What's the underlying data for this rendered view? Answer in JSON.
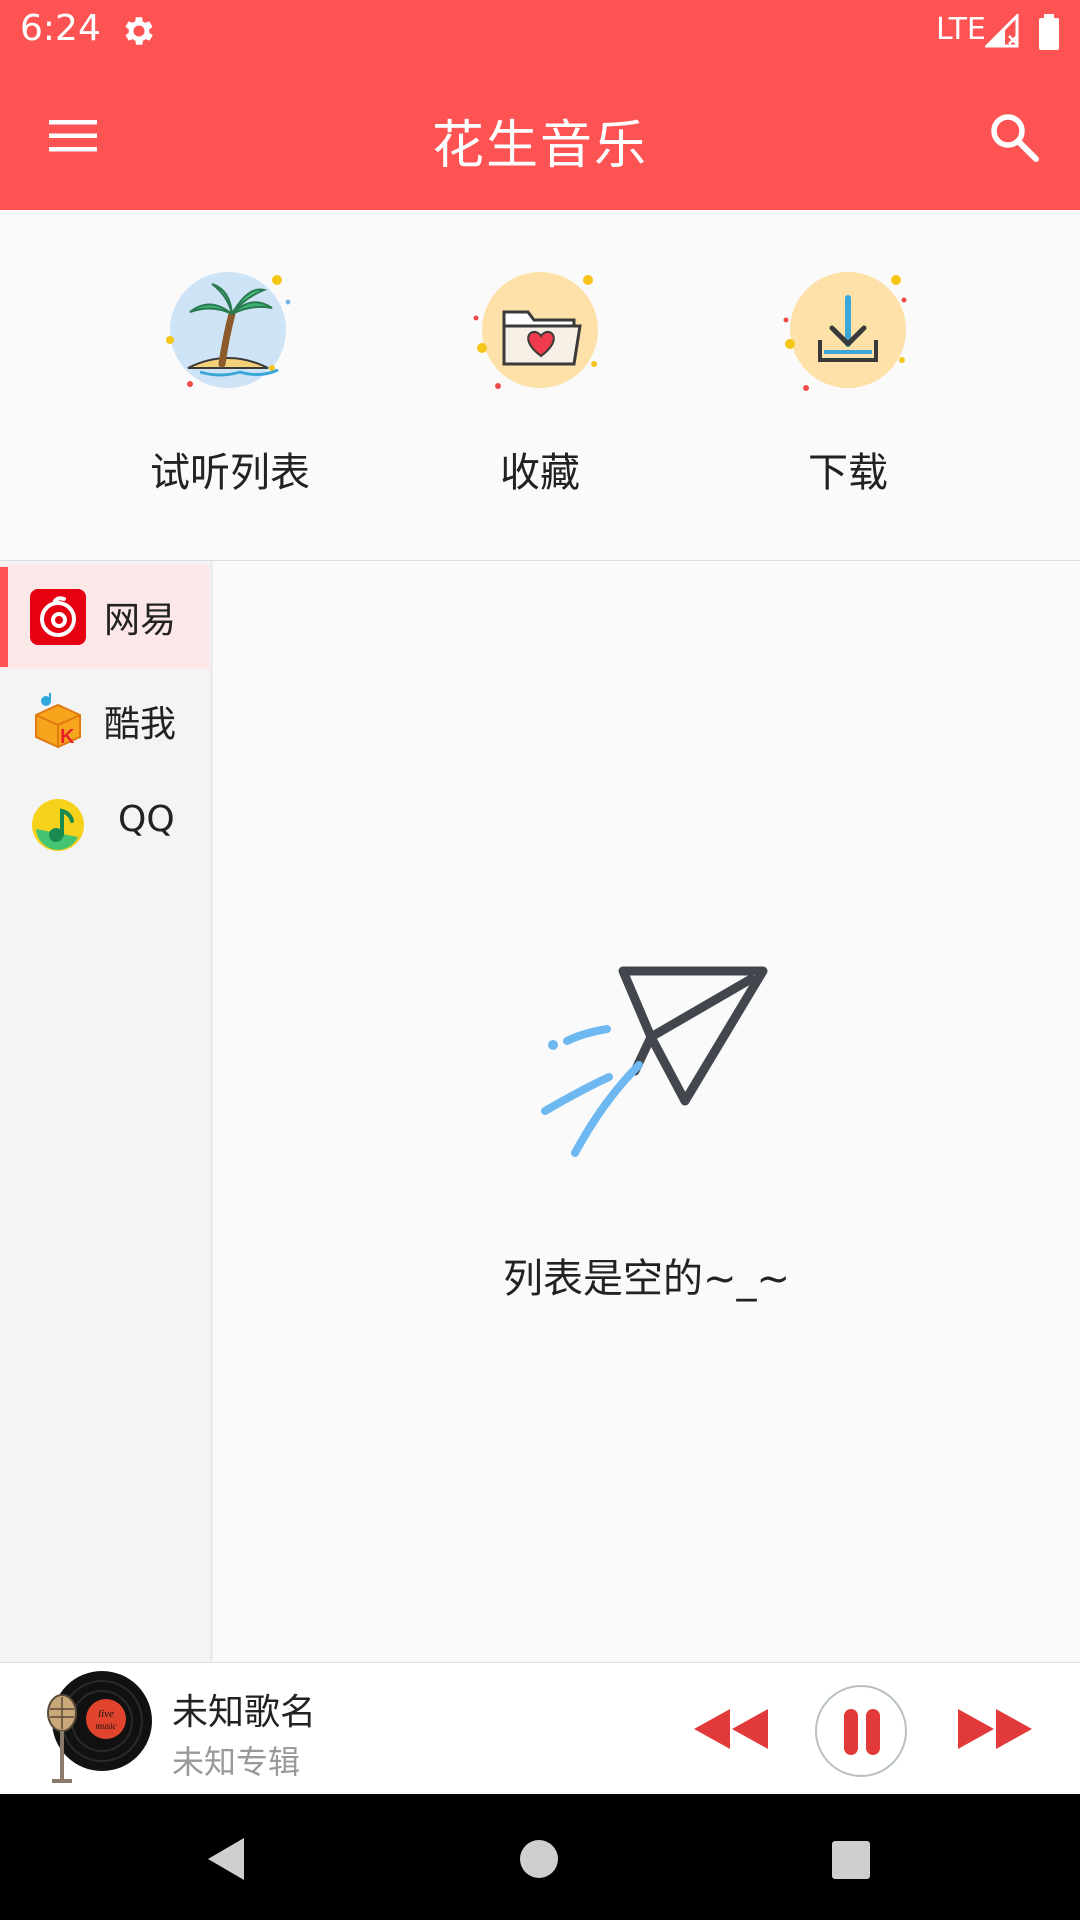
{
  "status_bar": {
    "time": "6:24",
    "network": "LTE"
  },
  "app_bar": {
    "title": "花生音乐"
  },
  "shortcuts": [
    {
      "label": "试听列表",
      "icon": "palm-tree-icon"
    },
    {
      "label": "收藏",
      "icon": "heart-folder-icon"
    },
    {
      "label": "下载",
      "icon": "download-icon"
    }
  ],
  "sources": [
    {
      "label": "网易",
      "icon": "netease-logo",
      "selected": true
    },
    {
      "label": "酷我",
      "icon": "kuwo-logo",
      "selected": false
    },
    {
      "label": "QQ",
      "icon": "qq-music-logo",
      "selected": false
    }
  ],
  "empty_state": {
    "message": "列表是空的~_~",
    "icon": "paper-plane-icon"
  },
  "player": {
    "song": "未知歌名",
    "album": "未知专辑",
    "cover_text": "live music",
    "is_playing": true
  },
  "colors": {
    "primary": "#fd5353",
    "accent": "#e23a3a",
    "background": "#fafafa",
    "selected_source_bg": "#fce8e8"
  }
}
